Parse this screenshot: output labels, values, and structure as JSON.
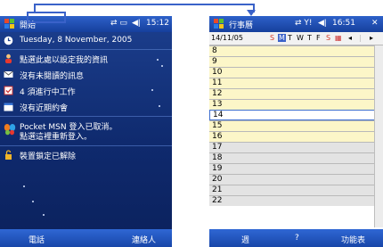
{
  "left_screen": {
    "start_label": "開始",
    "time": "15:12",
    "rows": [
      {
        "text": "Tuesday, 8 November, 2005",
        "icon": "clock-icon"
      },
      {
        "text": "點選此處以設定我的資訊",
        "icon": "person-icon"
      },
      {
        "text": "沒有未閱讀的訊息",
        "icon": "envelope-icon"
      },
      {
        "text": "4 須進行中工作",
        "icon": "task-icon"
      },
      {
        "text": "沒有近期約會",
        "icon": "calendar-icon"
      },
      {
        "text": "Pocket MSN 登入已取消。",
        "text2": "點選這裡重新登入。",
        "icon": "msn-butterfly-icon"
      },
      {
        "text": "裝置鎖定已解除",
        "icon": "lock-icon"
      }
    ],
    "softkey_left": "電話",
    "softkey_right": "連絡人"
  },
  "right_screen": {
    "title": "行事曆",
    "time": "16:51",
    "date": "14/11/05",
    "weekdays": [
      "S",
      "M",
      "T",
      "W",
      "T",
      "F",
      "S"
    ],
    "hours": [
      "8",
      "9",
      "10",
      "11",
      "12",
      "13",
      "14",
      "15",
      "16",
      "17",
      "18",
      "19",
      "20",
      "21",
      "22"
    ],
    "softkey_left": "週",
    "softkey_mid": "?",
    "softkey_right": "功能表"
  },
  "colors": {
    "accent": "#3a62c9",
    "calendar_yellow": "#fcf6c8"
  }
}
